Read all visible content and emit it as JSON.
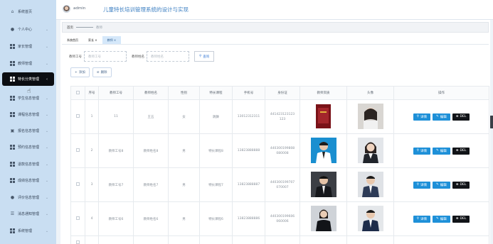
{
  "header": {
    "admin": "admin",
    "title": "儿童特长培训管理系统的设计与实现"
  },
  "sidebar": {
    "items": [
      {
        "label": "系统首页",
        "icon": "home-icon"
      },
      {
        "label": "个人中心",
        "icon": "user-icon"
      },
      {
        "label": "家长管理",
        "icon": "grid-icon"
      },
      {
        "label": "教师管理",
        "icon": "grid-icon"
      },
      {
        "label": "特长分类管理",
        "icon": "grid-icon"
      },
      {
        "label": "学生信息管理",
        "icon": "grid-icon"
      },
      {
        "label": "课程信息管理",
        "icon": "grid-icon"
      },
      {
        "label": "报名信息管理",
        "icon": "calendar-icon"
      },
      {
        "label": "预约信息管理",
        "icon": "grid-icon"
      },
      {
        "label": "退款信息管理",
        "icon": "grid-icon"
      },
      {
        "label": "成绩信息管理",
        "icon": "grid-icon"
      },
      {
        "label": "评价信息管理",
        "icon": "user-icon"
      },
      {
        "label": "消息通知管理",
        "icon": "list-icon"
      },
      {
        "label": "系统管理",
        "icon": "grid-icon"
      }
    ]
  },
  "breadcrumb": {
    "home": "首页",
    "current": "教师"
  },
  "tabs": [
    "系统首页",
    "家长 ×",
    "教师 ×"
  ],
  "search": {
    "label_no": "教师工号",
    "placeholder_no": "教师工号",
    "label_name": "教师姓名",
    "placeholder_name": "教师姓名",
    "query": "查询"
  },
  "actions": {
    "add": "添加",
    "delete": "删除"
  },
  "table": {
    "headers": [
      "",
      "序号",
      "教师工号",
      "教师姓名",
      "性别",
      "特长课程",
      "手机号",
      "身份证",
      "教师资质",
      "头像",
      "操作"
    ],
    "rows": [
      {
        "no": "1",
        "tid": "11",
        "name": "王五",
        "gender": "女",
        "course": "跳舞",
        "phone": "13012312311",
        "idcard": [
          "441423123123",
          "123"
        ]
      },
      {
        "no": "2",
        "tid": "教师工号8",
        "name": "教师姓名8",
        "gender": "男",
        "course": "特长课程8",
        "phone": "13823888888",
        "idcard": [
          "440300199808",
          "080008"
        ]
      },
      {
        "no": "3",
        "tid": "教师工号7",
        "name": "教师姓名7",
        "gender": "男",
        "course": "特长课程7",
        "phone": "13823888887",
        "idcard": [
          "440300199707",
          "070007"
        ]
      },
      {
        "no": "4",
        "tid": "教师工号6",
        "name": "教师姓名6",
        "gender": "男",
        "course": "特长课程6",
        "phone": "13823888886",
        "idcard": [
          "440300199606",
          "060006"
        ]
      }
    ],
    "ops": {
      "detail": "详情",
      "edit": "编辑",
      "del": "DEL"
    }
  }
}
